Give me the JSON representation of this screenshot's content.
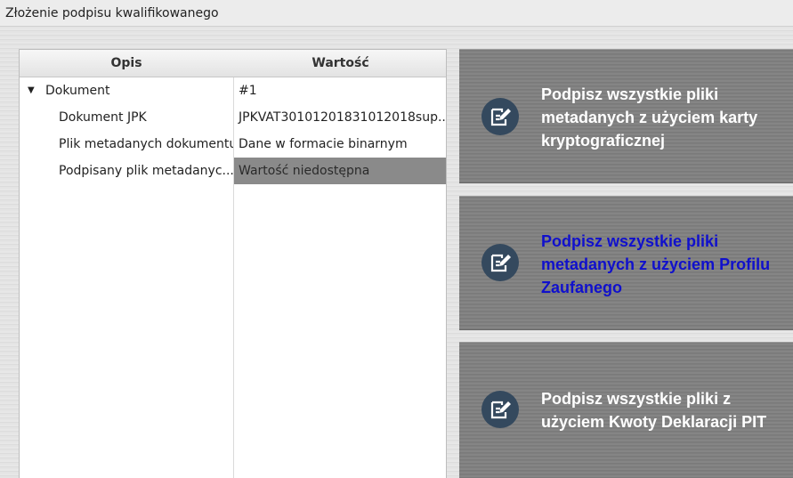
{
  "window": {
    "title": "Złożenie podpisu kwalifikowanego"
  },
  "table": {
    "headers": {
      "opis": "Opis",
      "wartosc": "Wartość"
    },
    "rows": [
      {
        "toggle": "▼",
        "label": "Dokument",
        "value": "#1"
      },
      {
        "label": "Dokument JPK",
        "value": "JPKVAT30101201831012018sup..."
      },
      {
        "label": "Plik metadanych dokumentu",
        "value": "Dane w formacie binarnym"
      },
      {
        "label": "Podpisany plik metadanyc...",
        "value": "Wartość niedostępna",
        "selected": true
      }
    ]
  },
  "actions": [
    {
      "icon": "signature-edit-icon",
      "label": "Podpisz wszystkie pliki metadanych z użyciem karty kryptograficznej"
    },
    {
      "icon": "signature-edit-icon",
      "label": "Podpisz wszystkie pliki metadanych z użyciem Profilu Zaufanego",
      "highlighted": true,
      "highlight_color": "#1010cc"
    },
    {
      "icon": "signature-edit-icon",
      "label": "Podpisz wszystkie pliki z użyciem Kwoty Deklaracji PIT"
    }
  ]
}
